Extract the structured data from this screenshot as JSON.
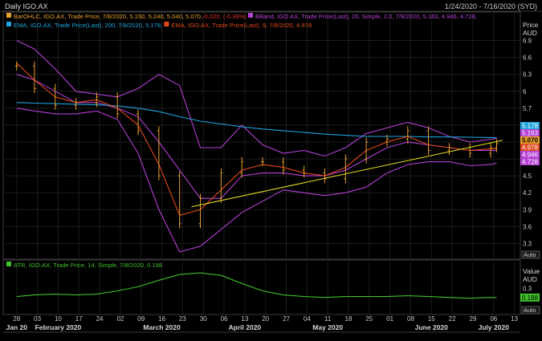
{
  "header": {
    "title": "Daily IGO.AX",
    "date_range": "1/24/2020 - 7/16/2020 (SYD)"
  },
  "colors": {
    "background": "#000000",
    "panel_border": "#3a3a3a",
    "grid": "#1c1c1c",
    "bars": "#e8a02c",
    "bband": "#b540d6",
    "ema200": "#1fa3dc",
    "ema9": "#e0481c",
    "trendline": "#e8e020",
    "atr": "#3fbf2a",
    "axis_text": "#c8c8c8"
  },
  "legend": {
    "line1": [
      {
        "text": "BarOHLC, IGO.AX, Trade Price,  7/8/2020, 5.150, 5.240, 5.040, 5.070, ",
        "color": "#e8a02c"
      },
      {
        "text": "-0.020, (-0.39%)",
        "color": "#e03030"
      },
      {
        "text": "BBand, IGO.AX, Trade Price(Last),  20, Simple, 2.0,  7/8/2020, 5.163, 4.946, 4.728,",
        "color": "#b540d6"
      }
    ],
    "line2": [
      {
        "text": "EMA, IGO.AX, Trade Price(Last),  200,  7/8/2020, 5.178,",
        "color": "#1fa3dc"
      },
      {
        "text": "EMA, IGO.AX, Trade Price(Last),  9,  7/8/2020, 4.978",
        "color": "#e0481c"
      }
    ],
    "atr_line": {
      "text": "ATR, IGO.AX, Trade Price,  14, Simple,  7/8/2020, 0.188",
      "color": "#3fbf2a"
    }
  },
  "price_axis": {
    "title": "Price",
    "unit": "AUD",
    "auto_label": "Auto",
    "ticks": [
      "6.9",
      "6.6",
      "6.3",
      "6",
      "5.7",
      "5.4",
      "5.1",
      "4.8",
      "4.5",
      "4.2",
      "3.9",
      "3.6",
      "3.3"
    ],
    "tick_values": [
      6.9,
      6.6,
      6.3,
      6.0,
      5.7,
      5.4,
      5.1,
      4.8,
      4.5,
      4.2,
      3.9,
      3.6,
      3.3
    ],
    "tags": [
      {
        "text": "5.178",
        "color": "#1fa3dc",
        "value": 5.178
      },
      {
        "text": "5.163",
        "color": "#b540d6",
        "value": 5.163
      },
      {
        "text": "5.070",
        "color": "#e8a02c",
        "value": 5.07
      },
      {
        "text": "4.978",
        "color": "#e0481c",
        "value": 4.978
      },
      {
        "text": "4.946",
        "color": "#b540d6",
        "value": 4.946
      },
      {
        "text": "4.728",
        "color": "#b540d6",
        "value": 4.728
      }
    ]
  },
  "atr_axis": {
    "title": "Value",
    "unit": "AUD",
    "auto_label": "Auto",
    "ticks": [
      "0.3"
    ],
    "tick_values": [
      0.3
    ],
    "tag": {
      "text": "0.188",
      "value": 0.188
    }
  },
  "x_axis": {
    "day_labels": [
      "28",
      "03",
      "10",
      "17",
      "24",
      "02",
      "09",
      "16",
      "23",
      "30",
      "06",
      "13",
      "20",
      "27",
      "04",
      "11",
      "18",
      "25",
      "01",
      "08",
      "15",
      "22",
      "29",
      "06",
      "13"
    ],
    "month_labels": [
      {
        "text": "Jan 20",
        "at_day": "28"
      },
      {
        "text": "February 2020",
        "at_day": "10"
      },
      {
        "text": "March 2020",
        "at_day": "16"
      },
      {
        "text": "April 2020",
        "at_day": "13"
      },
      {
        "text": "May 2020",
        "at_day": "11"
      },
      {
        "text": "June 2020",
        "at_day": "15"
      },
      {
        "text": "July 2020",
        "at_day": "06"
      }
    ]
  },
  "chart_data": {
    "type": "line",
    "title": "Daily IGO.AX",
    "ylabel": "Price AUD",
    "ylim": [
      3.05,
      7.05
    ],
    "x": [
      "2020-01-28",
      "2020-02-03",
      "2020-02-10",
      "2020-02-17",
      "2020-02-24",
      "2020-03-02",
      "2020-03-09",
      "2020-03-16",
      "2020-03-23",
      "2020-03-30",
      "2020-04-06",
      "2020-04-13",
      "2020-04-20",
      "2020-04-27",
      "2020-05-04",
      "2020-05-11",
      "2020-05-18",
      "2020-05-25",
      "2020-06-01",
      "2020-06-08",
      "2020-06-15",
      "2020-06-22",
      "2020-06-29",
      "2020-07-06",
      "2020-07-08"
    ],
    "series": [
      {
        "name": "BarOHLC close",
        "values": [
          6.45,
          6.05,
          5.75,
          5.8,
          5.9,
          5.6,
          5.3,
          4.5,
          3.65,
          4.1,
          4.55,
          4.75,
          4.75,
          4.6,
          4.55,
          4.45,
          4.8,
          5.1,
          5.15,
          5.3,
          4.95,
          5.0,
          4.9,
          5.0,
          5.07
        ]
      },
      {
        "name": "BBand upper",
        "values": [
          6.9,
          6.75,
          6.4,
          6.0,
          5.95,
          5.9,
          6.05,
          6.3,
          6.1,
          5.0,
          5.0,
          5.4,
          5.05,
          4.9,
          4.95,
          4.85,
          5.0,
          5.25,
          5.35,
          5.45,
          5.35,
          5.2,
          5.1,
          5.15,
          5.163
        ]
      },
      {
        "name": "BBand middle",
        "values": [
          6.3,
          6.2,
          6.0,
          5.8,
          5.8,
          5.7,
          5.55,
          5.1,
          4.6,
          4.1,
          4.1,
          4.5,
          4.55,
          4.55,
          4.5,
          4.5,
          4.6,
          4.8,
          5.0,
          5.1,
          5.05,
          5.0,
          4.95,
          4.95,
          4.946
        ]
      },
      {
        "name": "BBand lower",
        "values": [
          5.7,
          5.65,
          5.6,
          5.6,
          5.65,
          5.5,
          4.9,
          3.9,
          3.15,
          3.25,
          3.55,
          3.85,
          4.05,
          4.25,
          4.2,
          4.15,
          4.2,
          4.3,
          4.55,
          4.7,
          4.75,
          4.75,
          4.68,
          4.7,
          4.728
        ]
      },
      {
        "name": "EMA 200",
        "values": [
          5.8,
          5.79,
          5.78,
          5.77,
          5.76,
          5.74,
          5.7,
          5.64,
          5.55,
          5.47,
          5.42,
          5.37,
          5.33,
          5.3,
          5.27,
          5.24,
          5.22,
          5.2,
          5.2,
          5.2,
          5.19,
          5.19,
          5.185,
          5.18,
          5.178
        ]
      },
      {
        "name": "EMA 9",
        "values": [
          6.5,
          6.2,
          5.9,
          5.8,
          5.85,
          5.7,
          5.4,
          4.7,
          3.8,
          3.9,
          4.25,
          4.6,
          4.7,
          4.65,
          4.55,
          4.5,
          4.65,
          4.95,
          5.1,
          5.2,
          5.05,
          5.0,
          4.95,
          4.98,
          4.978
        ]
      }
    ],
    "atr": {
      "name": "ATR 14",
      "ylim": [
        0.0,
        0.55
      ],
      "values": [
        0.2,
        0.22,
        0.23,
        0.22,
        0.23,
        0.27,
        0.32,
        0.4,
        0.47,
        0.49,
        0.46,
        0.36,
        0.27,
        0.22,
        0.2,
        0.19,
        0.2,
        0.2,
        0.2,
        0.21,
        0.2,
        0.19,
        0.18,
        0.19,
        0.188
      ]
    },
    "trendline": {
      "from": {
        "x": "2020-03-27",
        "y": 3.95
      },
      "to": {
        "x": "2020-07-10",
        "y": 5.13
      }
    }
  }
}
